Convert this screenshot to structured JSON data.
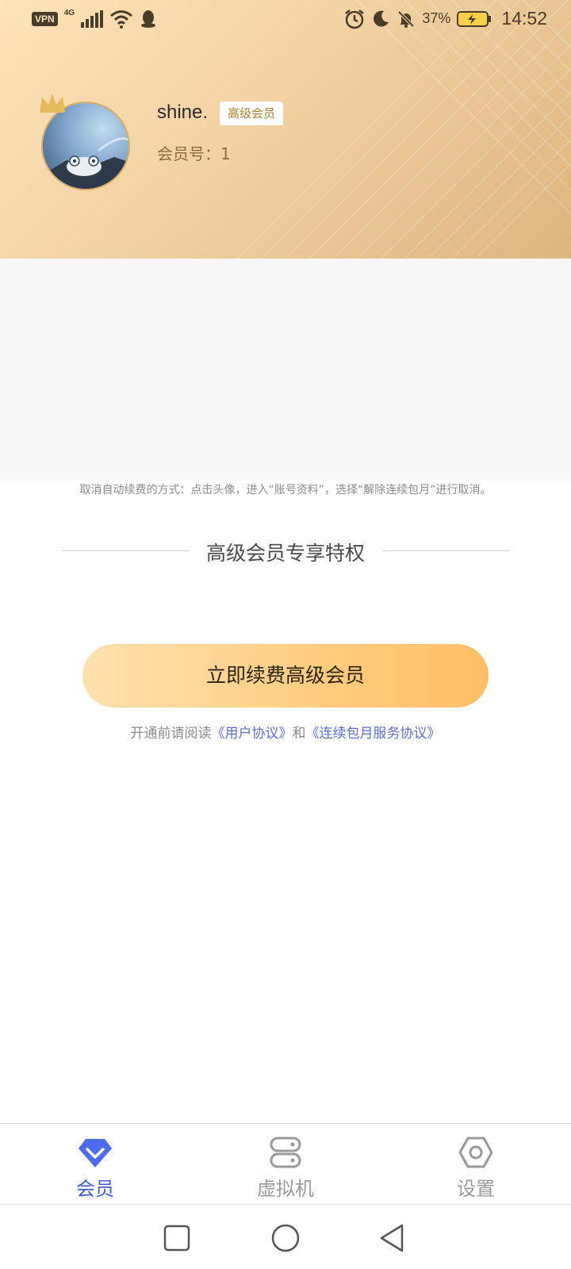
{
  "status_bar": {
    "vpn": "VPN",
    "network": "4G",
    "battery": "37%",
    "time": "14:52"
  },
  "profile": {
    "username": "shine.",
    "tier_badge": "高级会员",
    "member_no": "会员号：1"
  },
  "notice": {
    "cancel_text": "取消自动续费的方式：点击头像，进入“账号资料”，选择“解除连续包月”进行取消。"
  },
  "privileges": {
    "title": "高级会员专享特权"
  },
  "renew": {
    "button_label": "立即续费高级会员"
  },
  "agreement": {
    "prefix": "开通前请阅读",
    "user_agreement": "《用户协议》",
    "and": "和",
    "subscription_agreement": "《连续包月服务协议》"
  },
  "tabs": [
    {
      "label": "会员",
      "icon": "diamond-icon",
      "active": true
    },
    {
      "label": "虚拟机",
      "icon": "server-icon",
      "active": false
    },
    {
      "label": "设置",
      "icon": "hexagon-gear-icon",
      "active": false
    }
  ],
  "colors": {
    "accent": "#3f5fd8",
    "gold_badge_text": "#b08035",
    "button_gradient_start": "#ffe0ad",
    "button_gradient_end": "#ffbe65",
    "link": "#5b6fd0"
  }
}
